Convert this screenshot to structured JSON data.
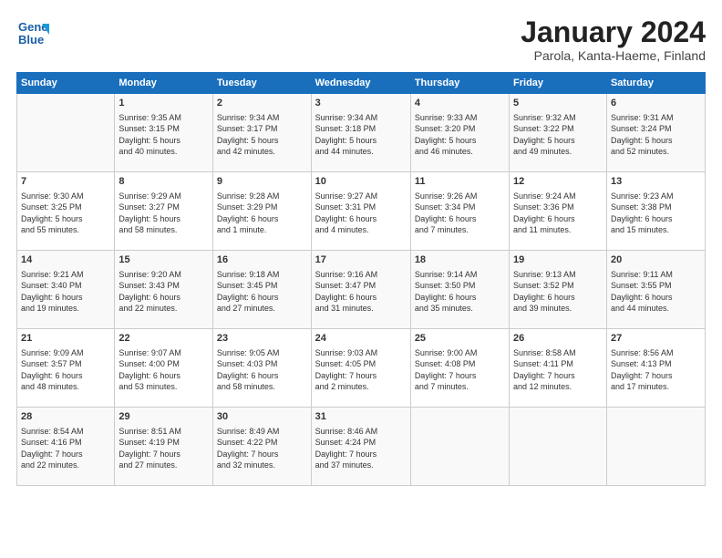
{
  "header": {
    "logo_line1": "General",
    "logo_line2": "Blue",
    "title": "January 2024",
    "subtitle": "Parola, Kanta-Haeme, Finland"
  },
  "columns": [
    "Sunday",
    "Monday",
    "Tuesday",
    "Wednesday",
    "Thursday",
    "Friday",
    "Saturday"
  ],
  "weeks": [
    [
      {
        "day": "",
        "info": ""
      },
      {
        "day": "1",
        "info": "Sunrise: 9:35 AM\nSunset: 3:15 PM\nDaylight: 5 hours\nand 40 minutes."
      },
      {
        "day": "2",
        "info": "Sunrise: 9:34 AM\nSunset: 3:17 PM\nDaylight: 5 hours\nand 42 minutes."
      },
      {
        "day": "3",
        "info": "Sunrise: 9:34 AM\nSunset: 3:18 PM\nDaylight: 5 hours\nand 44 minutes."
      },
      {
        "day": "4",
        "info": "Sunrise: 9:33 AM\nSunset: 3:20 PM\nDaylight: 5 hours\nand 46 minutes."
      },
      {
        "day": "5",
        "info": "Sunrise: 9:32 AM\nSunset: 3:22 PM\nDaylight: 5 hours\nand 49 minutes."
      },
      {
        "day": "6",
        "info": "Sunrise: 9:31 AM\nSunset: 3:24 PM\nDaylight: 5 hours\nand 52 minutes."
      }
    ],
    [
      {
        "day": "7",
        "info": "Sunrise: 9:30 AM\nSunset: 3:25 PM\nDaylight: 5 hours\nand 55 minutes."
      },
      {
        "day": "8",
        "info": "Sunrise: 9:29 AM\nSunset: 3:27 PM\nDaylight: 5 hours\nand 58 minutes."
      },
      {
        "day": "9",
        "info": "Sunrise: 9:28 AM\nSunset: 3:29 PM\nDaylight: 6 hours\nand 1 minute."
      },
      {
        "day": "10",
        "info": "Sunrise: 9:27 AM\nSunset: 3:31 PM\nDaylight: 6 hours\nand 4 minutes."
      },
      {
        "day": "11",
        "info": "Sunrise: 9:26 AM\nSunset: 3:34 PM\nDaylight: 6 hours\nand 7 minutes."
      },
      {
        "day": "12",
        "info": "Sunrise: 9:24 AM\nSunset: 3:36 PM\nDaylight: 6 hours\nand 11 minutes."
      },
      {
        "day": "13",
        "info": "Sunrise: 9:23 AM\nSunset: 3:38 PM\nDaylight: 6 hours\nand 15 minutes."
      }
    ],
    [
      {
        "day": "14",
        "info": "Sunrise: 9:21 AM\nSunset: 3:40 PM\nDaylight: 6 hours\nand 19 minutes."
      },
      {
        "day": "15",
        "info": "Sunrise: 9:20 AM\nSunset: 3:43 PM\nDaylight: 6 hours\nand 22 minutes."
      },
      {
        "day": "16",
        "info": "Sunrise: 9:18 AM\nSunset: 3:45 PM\nDaylight: 6 hours\nand 27 minutes."
      },
      {
        "day": "17",
        "info": "Sunrise: 9:16 AM\nSunset: 3:47 PM\nDaylight: 6 hours\nand 31 minutes."
      },
      {
        "day": "18",
        "info": "Sunrise: 9:14 AM\nSunset: 3:50 PM\nDaylight: 6 hours\nand 35 minutes."
      },
      {
        "day": "19",
        "info": "Sunrise: 9:13 AM\nSunset: 3:52 PM\nDaylight: 6 hours\nand 39 minutes."
      },
      {
        "day": "20",
        "info": "Sunrise: 9:11 AM\nSunset: 3:55 PM\nDaylight: 6 hours\nand 44 minutes."
      }
    ],
    [
      {
        "day": "21",
        "info": "Sunrise: 9:09 AM\nSunset: 3:57 PM\nDaylight: 6 hours\nand 48 minutes."
      },
      {
        "day": "22",
        "info": "Sunrise: 9:07 AM\nSunset: 4:00 PM\nDaylight: 6 hours\nand 53 minutes."
      },
      {
        "day": "23",
        "info": "Sunrise: 9:05 AM\nSunset: 4:03 PM\nDaylight: 6 hours\nand 58 minutes."
      },
      {
        "day": "24",
        "info": "Sunrise: 9:03 AM\nSunset: 4:05 PM\nDaylight: 7 hours\nand 2 minutes."
      },
      {
        "day": "25",
        "info": "Sunrise: 9:00 AM\nSunset: 4:08 PM\nDaylight: 7 hours\nand 7 minutes."
      },
      {
        "day": "26",
        "info": "Sunrise: 8:58 AM\nSunset: 4:11 PM\nDaylight: 7 hours\nand 12 minutes."
      },
      {
        "day": "27",
        "info": "Sunrise: 8:56 AM\nSunset: 4:13 PM\nDaylight: 7 hours\nand 17 minutes."
      }
    ],
    [
      {
        "day": "28",
        "info": "Sunrise: 8:54 AM\nSunset: 4:16 PM\nDaylight: 7 hours\nand 22 minutes."
      },
      {
        "day": "29",
        "info": "Sunrise: 8:51 AM\nSunset: 4:19 PM\nDaylight: 7 hours\nand 27 minutes."
      },
      {
        "day": "30",
        "info": "Sunrise: 8:49 AM\nSunset: 4:22 PM\nDaylight: 7 hours\nand 32 minutes."
      },
      {
        "day": "31",
        "info": "Sunrise: 8:46 AM\nSunset: 4:24 PM\nDaylight: 7 hours\nand 37 minutes."
      },
      {
        "day": "",
        "info": ""
      },
      {
        "day": "",
        "info": ""
      },
      {
        "day": "",
        "info": ""
      }
    ]
  ]
}
